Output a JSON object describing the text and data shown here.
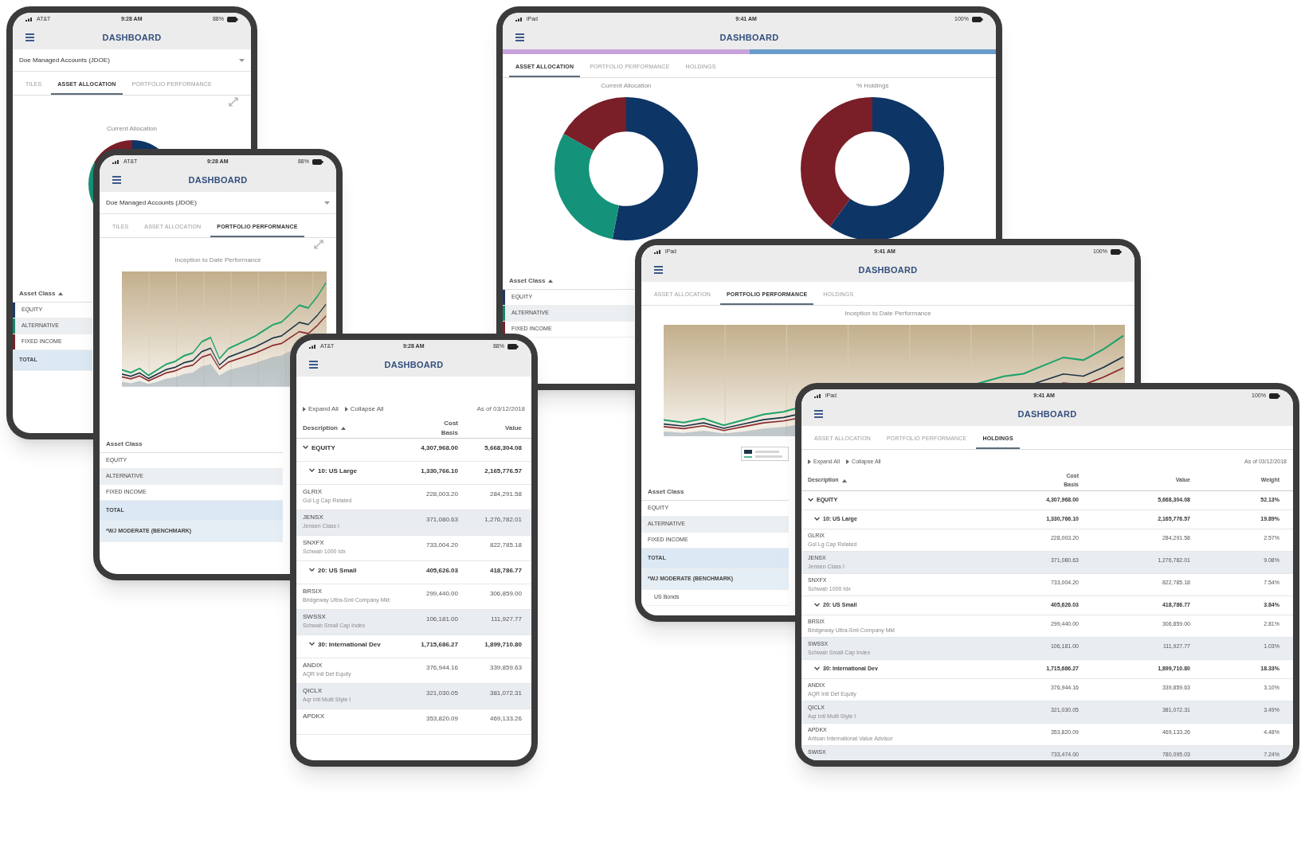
{
  "devices": [
    {
      "kind": "phone",
      "status": {
        "carrier": "AT&T",
        "time": "9:28 AM",
        "battery": "88%"
      },
      "title": "DASHBOARD",
      "account": "Doe Managed Accounts (JDOE)",
      "tabs": [
        {
          "label": "TILES",
          "selected": false
        },
        {
          "label": "ASSET ALLOCATION",
          "selected": true
        },
        {
          "label": "PORTFOLIO PERFORMANCE",
          "selected": false
        }
      ],
      "content": {
        "kind": "allocation",
        "charts": [
          {
            "title": "Current Allocation"
          }
        ],
        "table": {
          "header": "Asset Class",
          "sorted": true,
          "rows": [
            {
              "kind": "asset",
              "label": "EQUITY",
              "color": "#1b3a66"
            },
            {
              "kind": "asset",
              "label": "ALTERNATIVE",
              "color": "#16876e"
            },
            {
              "kind": "asset",
              "label": "FIXED INCOME",
              "color": "#7b2128"
            },
            {
              "kind": "total",
              "label": "TOTAL"
            }
          ]
        }
      }
    },
    {
      "kind": "phone",
      "status": {
        "carrier": "AT&T",
        "time": "9:28 AM",
        "battery": "88%"
      },
      "title": "DASHBOARD",
      "account": "Doe Managed Accounts (JDOE)",
      "tabs": [
        {
          "label": "TILES",
          "selected": false
        },
        {
          "label": "ASSET ALLOCATION",
          "selected": false
        },
        {
          "label": "PORTFOLIO PERFORMANCE",
          "selected": true
        }
      ],
      "content": {
        "kind": "performance",
        "chart_title": "Inception to Date Performance",
        "table": {
          "header": "Asset Class",
          "rows": [
            {
              "kind": "asset",
              "label": "EQUITY"
            },
            {
              "kind": "asset",
              "label": "ALTERNATIVE"
            },
            {
              "kind": "asset",
              "label": "FIXED INCOME"
            },
            {
              "kind": "total",
              "label": "TOTAL"
            },
            {
              "kind": "benchmark",
              "label": "*WJ MODERATE (BENCHMARK)"
            }
          ]
        }
      }
    },
    {
      "kind": "phone",
      "status": {
        "carrier": "AT&T",
        "time": "9:28 AM",
        "battery": "88%"
      },
      "title": "DASHBOARD",
      "content": {
        "kind": "holdings",
        "expand": "Expand All",
        "collapse": "Collapse All",
        "as_of": "As of 03/12/2018",
        "columns": [
          {
            "label": "Description",
            "sorted": true
          },
          {
            "label": "Cost Basis"
          },
          {
            "label": "Value"
          }
        ],
        "rows": [
          {
            "kind": "group",
            "label": "EQUITY",
            "expanded": true,
            "values": [
              "4,307,968.00",
              "5,668,304.08"
            ],
            "children": [
              {
                "kind": "group",
                "label": "10: US Large",
                "expanded": true,
                "values": [
                  "1,330,766.10",
                  "2,165,776.57"
                ],
                "children": [
                  {
                    "kind": "fund",
                    "ticker": "GLRIX",
                    "name": "Gol Lg Cap Related",
                    "values": [
                      "228,003.20",
                      "284,291.58"
                    ]
                  },
                  {
                    "kind": "fund",
                    "ticker": "JENSX",
                    "name": "Jensen Class I",
                    "values": [
                      "371,080.63",
                      "1,276,782.01"
                    ]
                  },
                  {
                    "kind": "fund",
                    "ticker": "SNXFX",
                    "name": "Schwab 1000 Idx",
                    "values": [
                      "733,004.20",
                      "822,785.18"
                    ]
                  }
                ]
              },
              {
                "kind": "group",
                "label": "20: US Small",
                "expanded": true,
                "values": [
                  "405,626.03",
                  "418,786.77"
                ],
                "children": [
                  {
                    "kind": "fund",
                    "ticker": "BRSIX",
                    "name": "Bridgeway Ultra-Sml Company Mkt",
                    "values": [
                      "299,440.00",
                      "306,859.00"
                    ]
                  },
                  {
                    "kind": "fund",
                    "ticker": "SWSSX",
                    "name": "Schwab Small Cap Index",
                    "values": [
                      "106,181.00",
                      "111,927.77"
                    ]
                  }
                ]
              },
              {
                "kind": "group",
                "label": "30: International Dev",
                "expanded": true,
                "values": [
                  "1,715,686.27",
                  "1,899,710.80"
                ],
                "children": [
                  {
                    "kind": "fund",
                    "ticker": "ANDIX",
                    "name": "AQR Intl Def Equity",
                    "values": [
                      "376,944.16",
                      "339,859.63"
                    ]
                  },
                  {
                    "kind": "fund",
                    "ticker": "QICLX",
                    "name": "Aqr Intl Multi Style I",
                    "values": [
                      "321,030.05",
                      "381,072.31"
                    ]
                  },
                  {
                    "kind": "fund",
                    "ticker": "APDKX",
                    "values": [
                      "353,820.09",
                      "469,133.26"
                    ]
                  }
                ]
              }
            ]
          }
        ]
      }
    },
    {
      "kind": "tablet",
      "status": {
        "carrier": "iPad",
        "time": "9:41 AM",
        "battery": "100%"
      },
      "title": "DASHBOARD",
      "progress": {
        "level": 0.5
      },
      "tabs": [
        {
          "label": "ASSET ALLOCATION",
          "selected": true
        },
        {
          "label": "PORTFOLIO PERFORMANCE",
          "selected": false
        },
        {
          "label": "HOLDINGS",
          "selected": false
        }
      ],
      "content": {
        "kind": "allocation",
        "charts": [
          {
            "title": "Current Allocation"
          },
          {
            "title": "% Holdings"
          }
        ],
        "table": {
          "header": "Asset Class",
          "sorted": true,
          "rows": [
            {
              "kind": "asset",
              "label": "EQUITY",
              "color": "#1b3a66"
            },
            {
              "kind": "asset",
              "label": "ALTERNATIVE",
              "color": "#16876e"
            },
            {
              "kind": "asset",
              "label": "FIXED INCOME",
              "color": "#7b2128"
            }
          ]
        }
      }
    },
    {
      "kind": "tablet",
      "status": {
        "carrier": "iPad",
        "time": "9:41 AM",
        "battery": "100%"
      },
      "title": "DASHBOARD",
      "tabs": [
        {
          "label": "ASSET ALLOCATION",
          "selected": false
        },
        {
          "label": "PORTFOLIO PERFORMANCE",
          "selected": true
        },
        {
          "label": "HOLDINGS",
          "selected": false
        }
      ],
      "content": {
        "kind": "performance",
        "chart_title": "Inception to Date Performance",
        "legend": true,
        "table": {
          "header": "Asset Class",
          "rows": [
            {
              "kind": "asset",
              "label": "EQUITY"
            },
            {
              "kind": "asset",
              "label": "ALTERNATIVE"
            },
            {
              "kind": "asset",
              "label": "FIXED INCOME"
            },
            {
              "kind": "total",
              "label": "TOTAL"
            },
            {
              "kind": "benchmark",
              "label": "*WJ MODERATE (BENCHMARK)"
            },
            {
              "kind": "sub",
              "label": "US Bonds"
            }
          ]
        }
      }
    },
    {
      "kind": "tablet",
      "status": {
        "carrier": "iPad",
        "time": "9:41 AM",
        "battery": "100%"
      },
      "title": "DASHBOARD",
      "tabs": [
        {
          "label": "ASSET ALLOCATION",
          "selected": false
        },
        {
          "label": "PORTFOLIO PERFORMANCE",
          "selected": false
        },
        {
          "label": "HOLDINGS",
          "selected": true
        }
      ],
      "content": {
        "kind": "holdings",
        "expand": "Expand All",
        "collapse": "Collapse All",
        "as_of": "As of 03/12/2018",
        "columns": [
          {
            "label": "Description",
            "sorted": true
          },
          {
            "label": "Cost Basis"
          },
          {
            "label": "Value"
          },
          {
            "label": "Weight"
          }
        ],
        "rows": [
          {
            "kind": "group",
            "label": "EQUITY",
            "expanded": true,
            "values": [
              "4,307,968.00",
              "5,668,304.08",
              "52.13%"
            ],
            "children": [
              {
                "kind": "group",
                "label": "10: US Large",
                "expanded": true,
                "values": [
                  "1,330,766.10",
                  "2,165,776.57",
                  "19.89%"
                ],
                "children": [
                  {
                    "kind": "fund",
                    "ticker": "GLRIX",
                    "name": "Gol Lg Cap Related",
                    "values": [
                      "228,003.20",
                      "284,291.58",
                      "2.57%"
                    ]
                  },
                  {
                    "kind": "fund",
                    "ticker": "JENSX",
                    "name": "Jensen Class I",
                    "values": [
                      "371,080.63",
                      "1,276,782.01",
                      "9.08%"
                    ]
                  },
                  {
                    "kind": "fund",
                    "ticker": "SNXFX",
                    "name": "Schwab 1000 Idx",
                    "values": [
                      "733,004.20",
                      "822,785.18",
                      "7.54%"
                    ]
                  }
                ]
              },
              {
                "kind": "group",
                "label": "20: US Small",
                "expanded": true,
                "values": [
                  "405,626.03",
                  "418,786.77",
                  "3.84%"
                ],
                "children": [
                  {
                    "kind": "fund",
                    "ticker": "BRSIX",
                    "name": "Bridgeway Ultra-Sml Company Mkt",
                    "values": [
                      "299,440.00",
                      "306,859.00",
                      "2.81%"
                    ]
                  },
                  {
                    "kind": "fund",
                    "ticker": "SWSSX",
                    "name": "Schwab Small Cap Index",
                    "values": [
                      "106,181.00",
                      "111,927.77",
                      "1.03%"
                    ]
                  }
                ]
              },
              {
                "kind": "group",
                "label": "30: International Dev",
                "expanded": true,
                "values": [
                  "1,715,686.27",
                  "1,899,710.80",
                  "18.33%"
                ],
                "children": [
                  {
                    "kind": "fund",
                    "ticker": "ANDIX",
                    "name": "AQR Intl Def Equity",
                    "values": [
                      "376,944.16",
                      "339,859.63",
                      "3.10%"
                    ]
                  },
                  {
                    "kind": "fund",
                    "ticker": "QICLX",
                    "name": "Aqr Intl Multi Style I",
                    "values": [
                      "321,030.05",
                      "381,072.31",
                      "3.49%"
                    ]
                  },
                  {
                    "kind": "fund",
                    "ticker": "APDKX",
                    "name": "Artisan International Value Advisor",
                    "values": [
                      "353,820.09",
                      "469,133.26",
                      "4.48%"
                    ]
                  },
                  {
                    "kind": "fund",
                    "ticker": "SWISX",
                    "values": [
                      "733,474.00",
                      "780,095.03",
                      "7.24%"
                    ]
                  }
                ]
              }
            ]
          }
        ]
      }
    }
  ]
}
